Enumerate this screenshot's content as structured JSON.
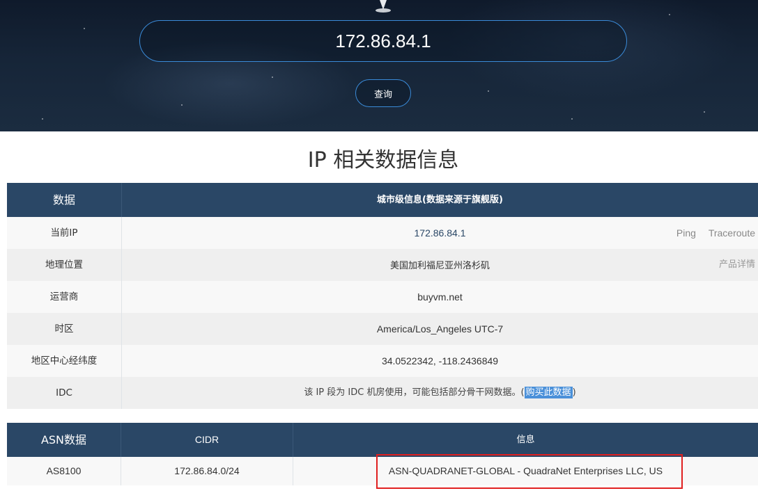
{
  "search": {
    "ip_value": "172.86.84.1",
    "query_label": "查询"
  },
  "section_title": "IP 相关数据信息",
  "info_table": {
    "header": {
      "col1": "数据",
      "col2": "城市级信息(数据来源于旗舰版)"
    },
    "rows": [
      {
        "label": "当前IP",
        "value": "172.86.84.1",
        "links": [
          "Ping",
          "Traceroute"
        ]
      },
      {
        "label": "地理位置",
        "value": "美国加利福尼亚州洛杉矶",
        "link": "产品详情"
      },
      {
        "label": "运营商",
        "value": "buyvm.net"
      },
      {
        "label": "时区",
        "value": "America/Los_Angeles UTC-7"
      },
      {
        "label": "地区中心经纬度",
        "value": "34.0522342, -118.2436849"
      },
      {
        "label": "IDC",
        "value_prefix": "该 IP 段为 IDC 机房使用，可能包括部分骨干网数据。(",
        "buy_link": "购买此数据",
        "value_suffix": ")"
      }
    ]
  },
  "asn_table": {
    "header": {
      "col1": "ASN数据",
      "col2": "CIDR",
      "col3": "信息"
    },
    "rows": [
      {
        "asn": "AS8100",
        "cidr": "172.86.84.0/24",
        "info": "ASN-QUADRANET-GLOBAL - QuadraNet Enterprises LLC, US"
      }
    ]
  },
  "colors": {
    "header_bg": "#2a4766",
    "accent": "#3a8bd9",
    "highlight_border": "#e02020",
    "link_bg": "#4a90d9"
  }
}
